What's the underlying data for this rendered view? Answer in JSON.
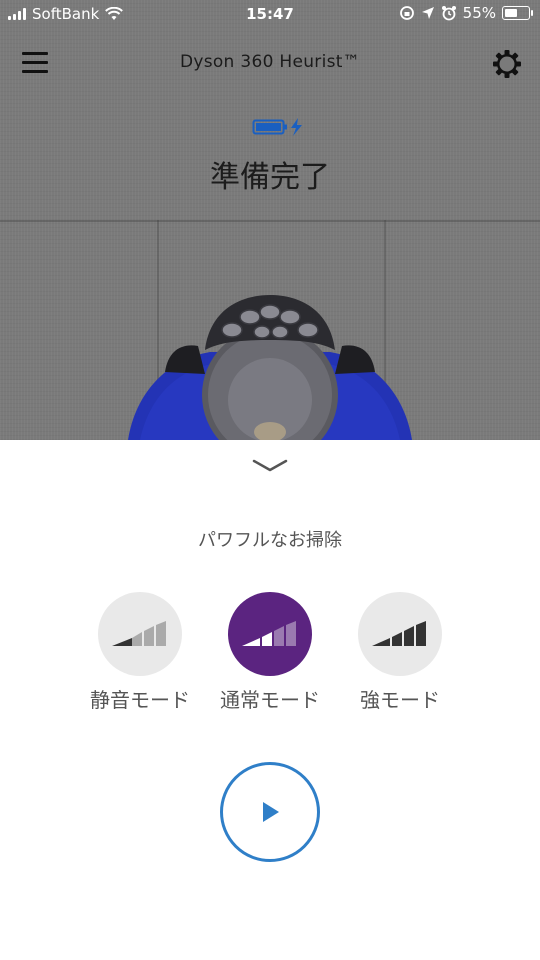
{
  "status_bar": {
    "carrier": "SoftBank",
    "time": "15:47",
    "battery_percent": "55%"
  },
  "header": {
    "title": "Dyson 360 Heurist™",
    "menu_icon": "hamburger-menu-icon",
    "settings_icon": "gear-icon"
  },
  "robot_status": {
    "battery_icon": "battery-charging-icon",
    "status_text": "準備完了"
  },
  "sheet": {
    "title": "パワフルなお掃除",
    "modes": [
      {
        "label": "静音モード",
        "icon": "power-level-low-icon",
        "selected": false
      },
      {
        "label": "通常モード",
        "icon": "power-level-medium-icon",
        "selected": true
      },
      {
        "label": "強モード",
        "icon": "power-level-high-icon",
        "selected": false
      }
    ],
    "play_icon": "play-icon"
  },
  "colors": {
    "selected_mode": "#5b2480",
    "play_accent": "#2f7fc8",
    "robot_blue": "#2030b8"
  }
}
